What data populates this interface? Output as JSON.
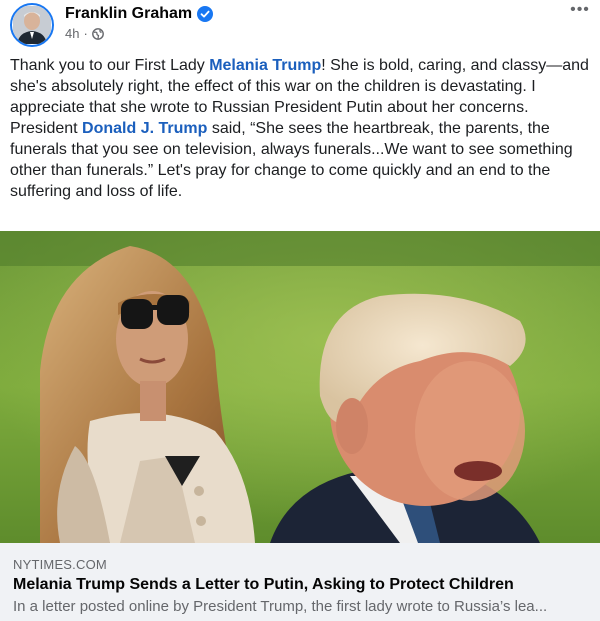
{
  "post": {
    "author": "Franklin Graham",
    "time": "4h",
    "separator": "·",
    "more_label": "•••",
    "text": {
      "p1": "Thank you to our First Lady ",
      "mention1": "Melania Trump",
      "p2": "! She is bold, caring, and classy—and she's absolutely right, the effect of this war on the children is devastating. I appreciate that she wrote to Russian President Putin about her concerns. President ",
      "mention2": "Donald J. Trump",
      "p3": " said, “She sees the heartbreak, the parents, the funerals that you see on television, always funerals...We want to see something other than funerals.” Let's pray for change to come quickly and an end to the suffering and loss of life."
    }
  },
  "link_preview": {
    "domain": "NYTIMES.COM",
    "title": "Melania Trump Sends a Letter to Putin, Asking to Protect Children",
    "description": "In a letter posted online by President Trump, the first lady wrote to Russia’s lea..."
  },
  "icons": {
    "verified": "verified-badge-icon",
    "audience": "globe-icon",
    "more": "more-options-icon"
  },
  "colors": {
    "accent": "#1877f2",
    "mention": "#1b5fbd",
    "meta": "#65676b",
    "card_bg": "#f0f2f5"
  }
}
